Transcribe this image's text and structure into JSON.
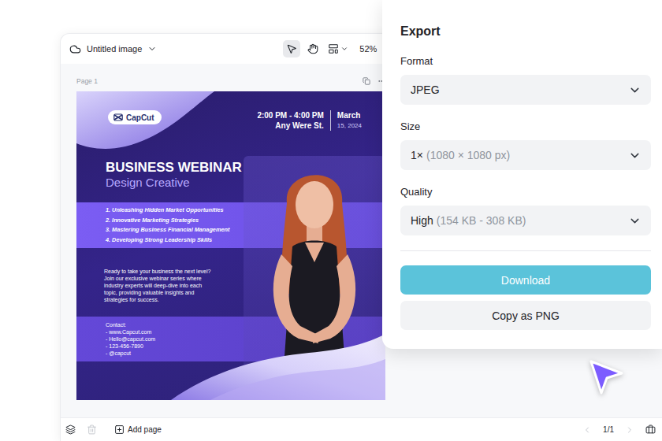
{
  "editor": {
    "title": "Untitled image",
    "zoom": "52%",
    "tools": [
      {
        "kind": "pointer",
        "selected": true
      },
      {
        "kind": "hand",
        "selected": false
      },
      {
        "kind": "layout",
        "selected": false
      }
    ],
    "page_label": "Page 1"
  },
  "poster": {
    "brand": "CapCut",
    "time": "2:00 PM - 4:00 PM",
    "place": "Any Were St.",
    "month": "March",
    "date": "15, 2024",
    "title": "BUSINESS WEBINAR",
    "subtitle": "Design Creative",
    "topics": [
      "1. Unleashing Hidden Market Opportunities",
      "2. Innovative Marketing Strategies",
      "3. Mastering Business Financial Management",
      "4. Developing Strong Leadership Skills"
    ],
    "intro_lines": [
      "Ready to take your business the next level?",
      "Join our exclusive webinar series where",
      "industry experts will deep-dive into each",
      "topic, providing valuable insights and",
      "strategies for success."
    ],
    "contact_label": "Contact:",
    "contacts": [
      "- www.Capcut.com",
      "- Hello@capcut.com",
      "- 123-456-7890",
      "- @capcut"
    ]
  },
  "bottom_bar": {
    "page_tools": [
      {
        "kind": "layers",
        "disabled": false
      },
      {
        "kind": "trash",
        "disabled": true
      }
    ],
    "add_page": "Add page",
    "pager": {
      "text": "1/1",
      "prev_disabled": true,
      "next_disabled": true
    }
  },
  "export": {
    "title": "Export",
    "fields": [
      {
        "label": "Format",
        "value": "JPEG"
      },
      {
        "label": "Size",
        "value": "1×",
        "hint": "(1080 × 1080 px)"
      },
      {
        "label": "Quality",
        "value": "High",
        "hint": "(154 KB - 308 KB)"
      }
    ],
    "primary_button": "Download",
    "secondary_button": "Copy as PNG"
  }
}
